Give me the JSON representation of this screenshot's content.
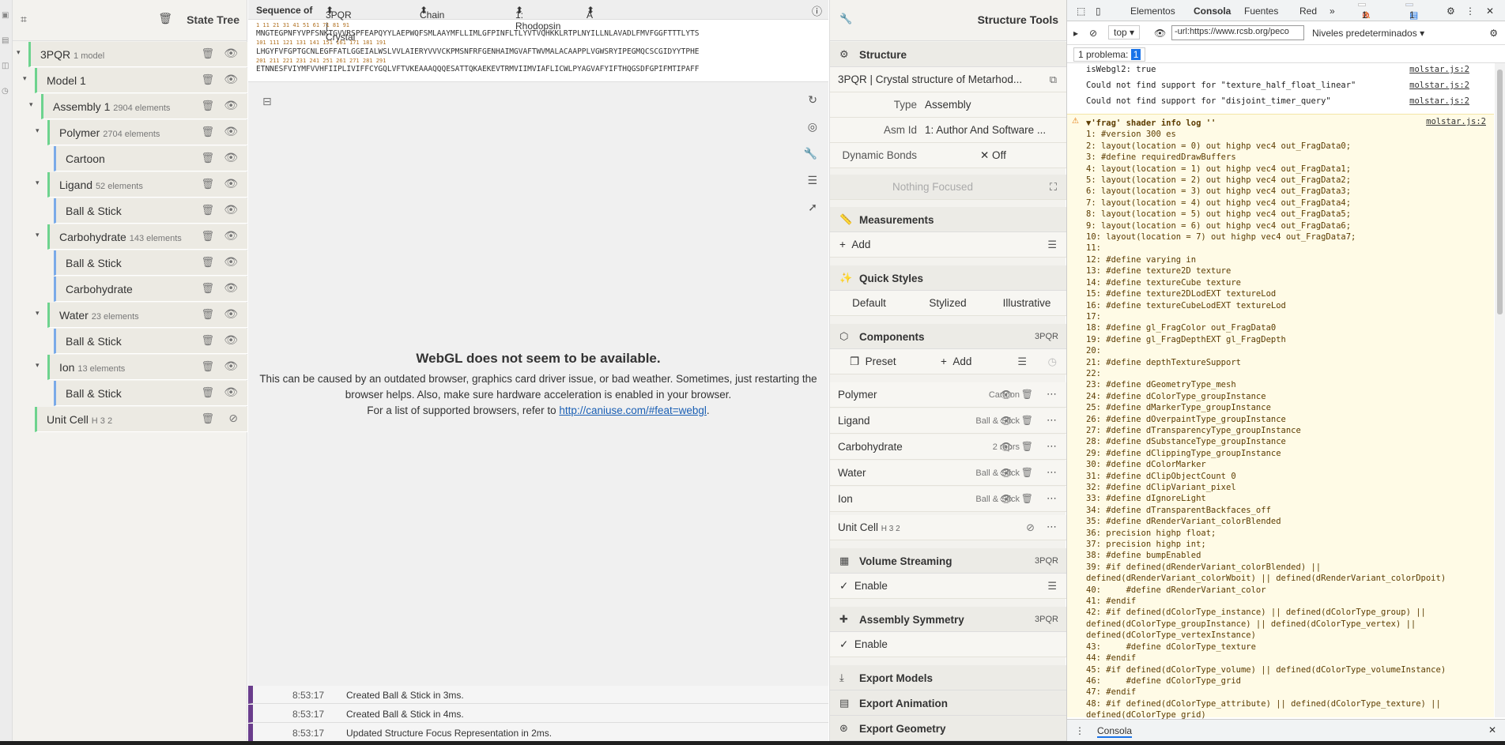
{
  "tree": {
    "title": "State Tree",
    "rows": [
      {
        "label": "3PQR",
        "sub": "1 model"
      },
      {
        "label": "Model 1",
        "sub": ""
      },
      {
        "label": "Assembly 1",
        "sub": "2904 elements"
      },
      {
        "label": "Polymer",
        "sub": "2704 elements"
      },
      {
        "label": "Cartoon",
        "sub": ""
      },
      {
        "label": "Ligand",
        "sub": "52 elements"
      },
      {
        "label": "Ball & Stick",
        "sub": ""
      },
      {
        "label": "Carbohydrate",
        "sub": "143 elements"
      },
      {
        "label": "Ball & Stick",
        "sub": ""
      },
      {
        "label": "Carbohydrate",
        "sub": ""
      },
      {
        "label": "Water",
        "sub": "23 elements"
      },
      {
        "label": "Ball & Stick",
        "sub": ""
      },
      {
        "label": "Ion",
        "sub": "13 elements"
      },
      {
        "label": "Ball & Stick",
        "sub": ""
      },
      {
        "label": "Unit Cell",
        "sub": "H 3 2"
      }
    ]
  },
  "sequence": {
    "label": "Sequence of",
    "entity": "3PQR | Crystal ...",
    "mode": "Chain",
    "chain": "1: Rhodopsin",
    "asym": "A",
    "line1": "MNGTEGPNFYVPFSNKTGVVRSPFEAPQYYLAEPWQFSMLAAYMFLLIMLGFPINFLTLYVTVQHKKLRTPLNYILLNLAVADLFMVFGGFTTTLYTS",
    "line2": "LHGYFVFGPTGCNLEGFFATLGGEIALWSLVVLAIERYVVVCKPMSNFRFGENHAIMGVAFTWVMALACAAPPLVGWSRYIPEGMQCSCGIDYYTPHE",
    "line3": "ETNNESFVIYMFVVHFIIPLIVIFFCYGQLVFTVKEAAAQQQESATTQKAEKEVTRMVIIMVIAFLICWLPYAGVAFYIFTHQGSDFGPIFMTIPAFF",
    "nums1": "1        11        21        31        41        51        61        71        81        91",
    "nums2": "101       111       121       131       141       151       161       171       181       191",
    "nums3": "201       211       221       231       241       251       261       271       281       291"
  },
  "webgl": {
    "title": "WebGL does not seem to be available.",
    "line1": "This can be caused by an outdated browser, graphics card driver issue, or bad weather. Sometimes, just restarting the",
    "line2": "browser helps. Also, make sure hardware acceleration is enabled in your browser.",
    "line3": "For a list of supported browsers, refer to",
    "link": "http://caniuse.com/#feat=webgl",
    "dot": "."
  },
  "log": [
    {
      "time": "8:53:17",
      "msg": "Created Ball & Stick in 3ms."
    },
    {
      "time": "8:53:17",
      "msg": "Created Ball & Stick in 4ms."
    },
    {
      "time": "8:53:17",
      "msg": "Updated Structure Focus Representation in 2ms."
    }
  ],
  "tools": {
    "title": "Structure Tools",
    "structure": "Structure",
    "entry": "3PQR | Crystal structure of Metarhod...",
    "type_k": "Type",
    "type_v": "Assembly",
    "asm_k": "Asm Id",
    "asm_v": "1: Author And Software ...",
    "bonds_k": "Dynamic Bonds",
    "bonds_v": "✕  Off",
    "focus": "Nothing Focused",
    "measurements": "Measurements",
    "add": "Add",
    "quick_styles": "Quick Styles",
    "styles": [
      "Default",
      "Stylized",
      "Illustrative"
    ],
    "components": "Components",
    "components_id": "3PQR",
    "preset": "Preset",
    "comp_add": "Add",
    "comps": [
      {
        "name": "Polymer",
        "repr": "Cartoon"
      },
      {
        "name": "Ligand",
        "repr": "Ball & Stick"
      },
      {
        "name": "Carbohydrate",
        "repr": "2 reprs"
      },
      {
        "name": "Water",
        "repr": "Ball & Stick"
      },
      {
        "name": "Ion",
        "repr": "Ball & Stick"
      }
    ],
    "unitcell": "Unit Cell",
    "unitcell_sub": "H 3 2",
    "volume": "Volume Streaming",
    "volume_id": "3PQR",
    "enable": "Enable",
    "symmetry": "Assembly Symmetry",
    "symmetry_id": "3PQR",
    "export_models": "Export Models",
    "export_animation": "Export Animation",
    "export_geometry": "Export Geometry"
  },
  "devtools": {
    "tabs": [
      "Elementos",
      "Consola",
      "Fuentes",
      "Red"
    ],
    "err_count": "1",
    "warn_count": "1",
    "info_count": "1",
    "context": "top",
    "filter": "-url:https://www.rcsb.org/peco",
    "levels": "Niveles predeterminados",
    "problems": "1 problema:",
    "problems_count": "1",
    "lines": [
      {
        "text": "isWebgl2: true",
        "src": "molstar.js:2"
      },
      {
        "text": "Could not find support for \"texture_half_float_linear\"",
        "src": "molstar.js:2"
      },
      {
        "text": "Could not find support for \"disjoint_timer_query\"",
        "src": "molstar.js:2"
      }
    ],
    "warn_head": "▼'frag' shader info log ''",
    "warn_src": "molstar.js:2",
    "shader": "1: #version 300 es\n2: layout(location = 0) out highp vec4 out_FragData0;\n3: #define requiredDrawBuffers\n4: layout(location = 1) out highp vec4 out_FragData1;\n5: layout(location = 2) out highp vec4 out_FragData2;\n6: layout(location = 3) out highp vec4 out_FragData3;\n7: layout(location = 4) out highp vec4 out_FragData4;\n8: layout(location = 5) out highp vec4 out_FragData5;\n9: layout(location = 6) out highp vec4 out_FragData6;\n10: layout(location = 7) out highp vec4 out_FragData7;\n11:\n12: #define varying in\n13: #define texture2D texture\n14: #define textureCube texture\n15: #define texture2DLodEXT textureLod\n16: #define textureCubeLodEXT textureLod\n17:\n18: #define gl_FragColor out_FragData0\n19: #define gl_FragDepthEXT gl_FragDepth\n20:\n21: #define depthTextureSupport\n22:\n23: #define dGeometryType_mesh\n24: #define dColorType_groupInstance\n25: #define dMarkerType_groupInstance\n26: #define dOverpaintType_groupInstance\n27: #define dTransparencyType_groupInstance\n28: #define dSubstanceType_groupInstance\n29: #define dClippingType_groupInstance\n30: #define dColorMarker\n31: #define dClipObjectCount 0\n32: #define dClipVariant_pixel\n33: #define dIgnoreLight\n34: #define dTransparentBackfaces_off\n35: #define dRenderVariant_colorBlended\n36: precision highp float;\n37: precision highp int;\n38: #define bumpEnabled\n39: #if defined(dRenderVariant_colorBlended) ||\ndefined(dRenderVariant_colorWboit) || defined(dRenderVariant_colorDpoit)\n40:     #define dRenderVariant_color\n41: #endif\n42: #if defined(dColorType_instance) || defined(dColorType_group) ||\ndefined(dColorType_groupInstance) || defined(dColorType_vertex) ||\ndefined(dColorType_vertexInstance)\n43:     #define dColorType_texture\n44: #endif\n45: #if defined(dColorType_volume) || defined(dColorType_volumeInstance)\n46:     #define dColorType_grid\n47: #endif\n48: #if defined(dColorType_attribute) || defined(dColorType_texture) ||\ndefined(dColorType_grid)",
    "footer": "Consola"
  }
}
